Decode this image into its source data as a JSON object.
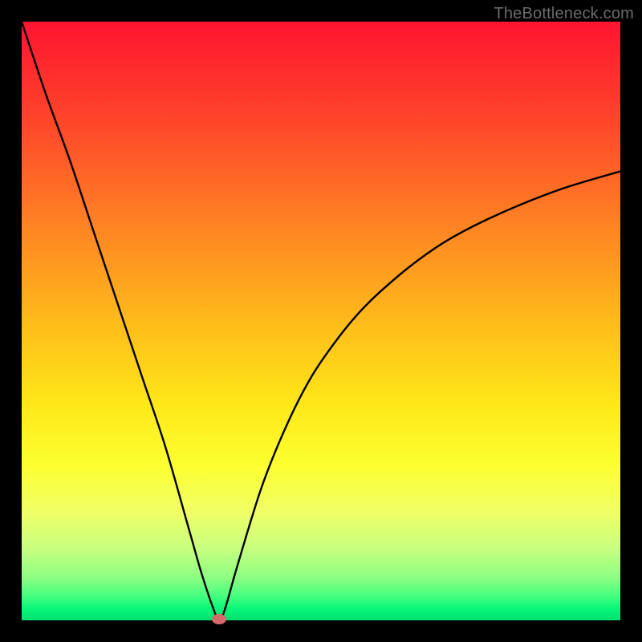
{
  "watermark": "TheBottleneck.com",
  "chart_data": {
    "type": "line",
    "title": "",
    "xlabel": "",
    "ylabel": "",
    "xlim": [
      0,
      100
    ],
    "ylim": [
      0,
      100
    ],
    "grid": false,
    "series": [
      {
        "name": "curve",
        "x": [
          0,
          4,
          8,
          12,
          16,
          20,
          24,
          28,
          30,
          32,
          33,
          34,
          36,
          40,
          44,
          48,
          52,
          56,
          60,
          66,
          72,
          80,
          90,
          100
        ],
        "y": [
          100,
          88,
          77,
          65,
          53,
          41,
          29,
          15,
          8,
          2,
          0,
          2,
          9,
          22,
          32,
          40,
          46,
          51,
          55,
          60,
          64,
          68,
          72,
          75
        ]
      }
    ],
    "minimum_marker": {
      "x": 33,
      "y": 0,
      "color": "#d56a6d"
    },
    "gradient_stops": [
      {
        "pos": 0.0,
        "color": "#ff1430"
      },
      {
        "pos": 0.18,
        "color": "#ff4a2a"
      },
      {
        "pos": 0.36,
        "color": "#ff8a22"
      },
      {
        "pos": 0.52,
        "color": "#ffc11a"
      },
      {
        "pos": 0.64,
        "color": "#ffe818"
      },
      {
        "pos": 0.74,
        "color": "#fcff30"
      },
      {
        "pos": 0.82,
        "color": "#f0ff66"
      },
      {
        "pos": 0.88,
        "color": "#c8ff80"
      },
      {
        "pos": 0.93,
        "color": "#8aff82"
      },
      {
        "pos": 0.96,
        "color": "#43ff80"
      },
      {
        "pos": 0.98,
        "color": "#0bf779"
      },
      {
        "pos": 1.0,
        "color": "#00e072"
      }
    ]
  }
}
